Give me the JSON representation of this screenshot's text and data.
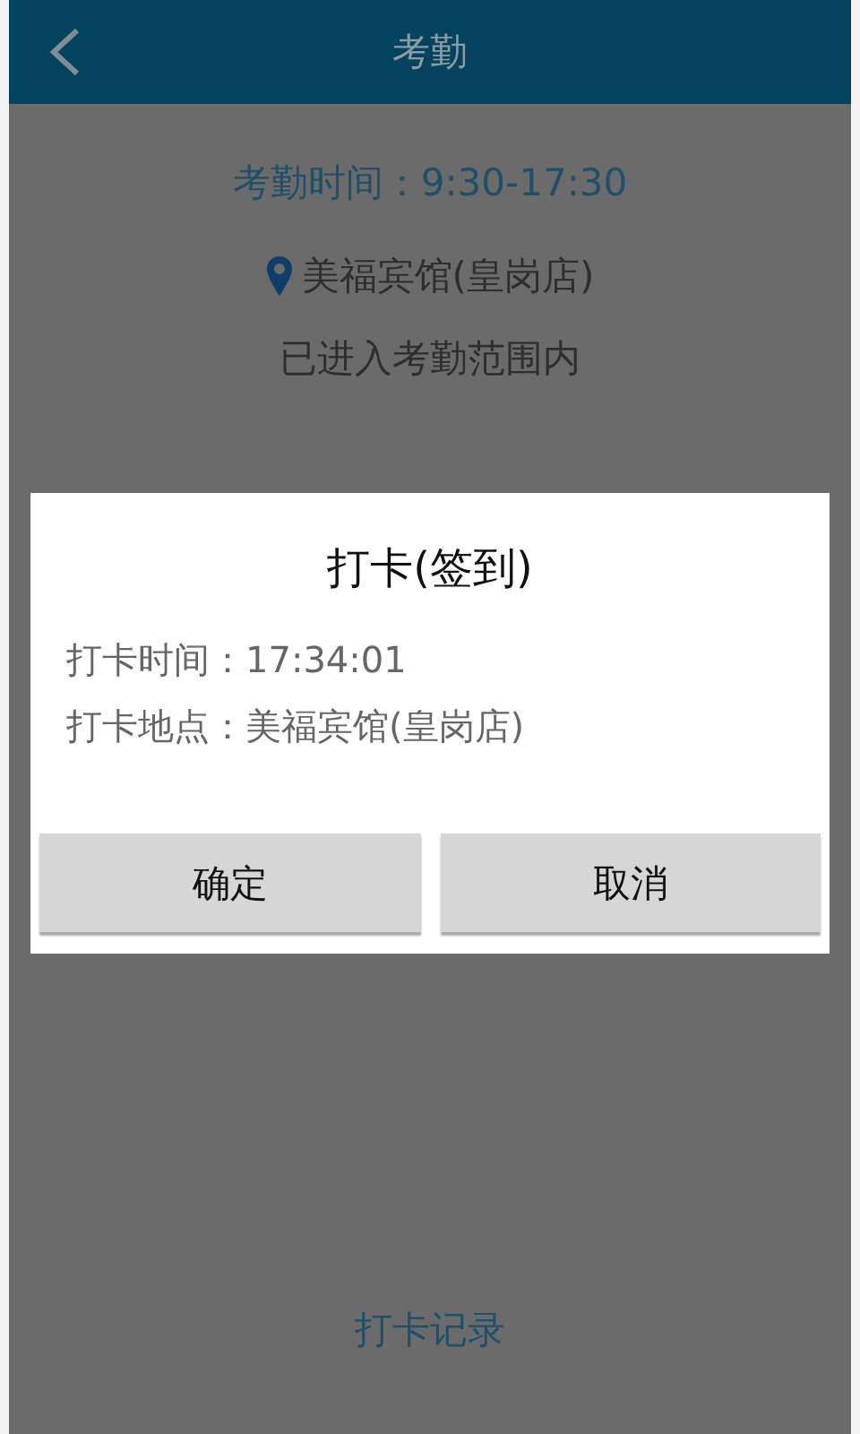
{
  "header": {
    "title": "考勤"
  },
  "attendance": {
    "hours": "考勤时间：9:30-17:30",
    "location": "美福宾馆(皇岗店)",
    "status": "已进入考勤范围内"
  },
  "dialog": {
    "title": "打卡(签到)",
    "lines": [
      "打卡时间：17:34:01",
      "打卡地点：美福宾馆(皇岗店)"
    ],
    "buttons": [
      "确定",
      "取消"
    ]
  },
  "records_link": "打卡记录"
}
